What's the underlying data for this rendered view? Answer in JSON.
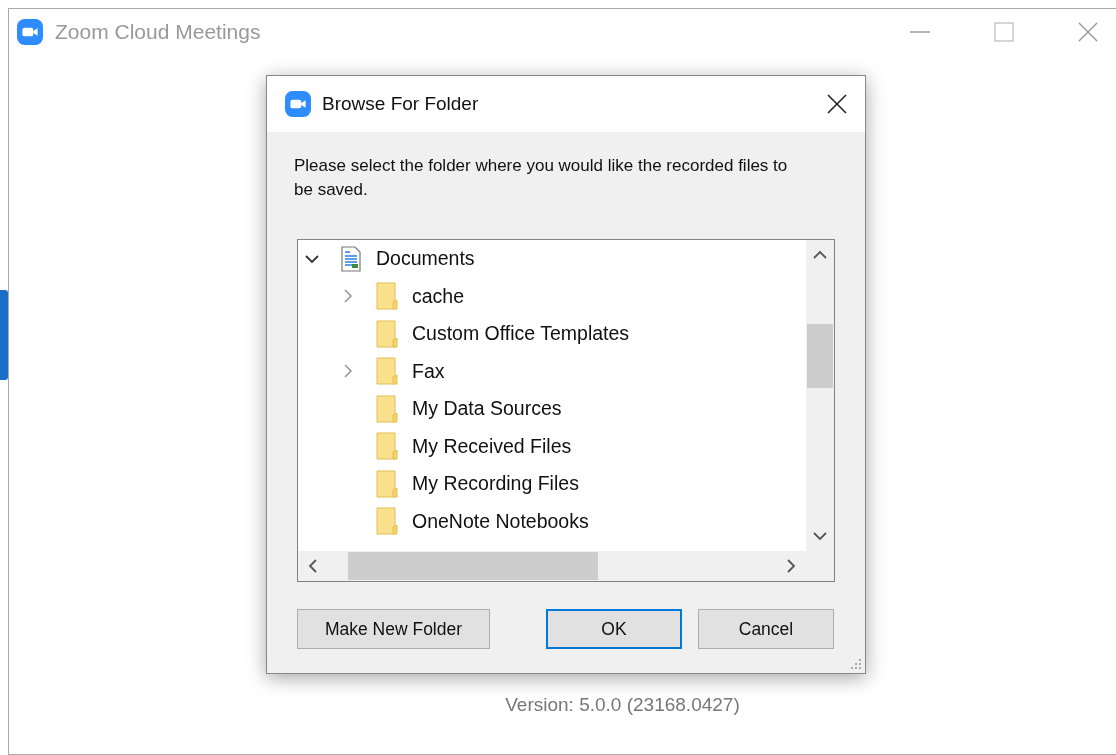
{
  "window": {
    "title": "Zoom Cloud Meetings",
    "active": false
  },
  "dialog": {
    "title": "Browse For Folder",
    "prompt": "Please select the folder where you would like the recorded files to be saved.",
    "tree": [
      {
        "label": "Documents",
        "kind": "library",
        "expandable": true,
        "expanded": true,
        "children": [
          {
            "label": "cache",
            "kind": "folder",
            "expandable": true,
            "expanded": false
          },
          {
            "label": "Custom Office Templates",
            "kind": "folder",
            "expandable": false,
            "expanded": false
          },
          {
            "label": "Fax",
            "kind": "folder",
            "expandable": true,
            "expanded": false
          },
          {
            "label": "My Data Sources",
            "kind": "folder",
            "expandable": false,
            "expanded": false
          },
          {
            "label": "My Received Files",
            "kind": "folder",
            "expandable": false,
            "expanded": false
          },
          {
            "label": "My Recording Files",
            "kind": "folder",
            "expandable": false,
            "expanded": false
          },
          {
            "label": "OneNote Notebooks",
            "kind": "folder",
            "expandable": false,
            "expanded": false
          }
        ]
      }
    ],
    "buttons": [
      {
        "label": "Make New Folder",
        "default": false
      },
      {
        "label": "OK",
        "default": true
      },
      {
        "label": "Cancel",
        "default": false
      }
    ]
  },
  "version": "Version: 5.0.0 (23168.0427)"
}
